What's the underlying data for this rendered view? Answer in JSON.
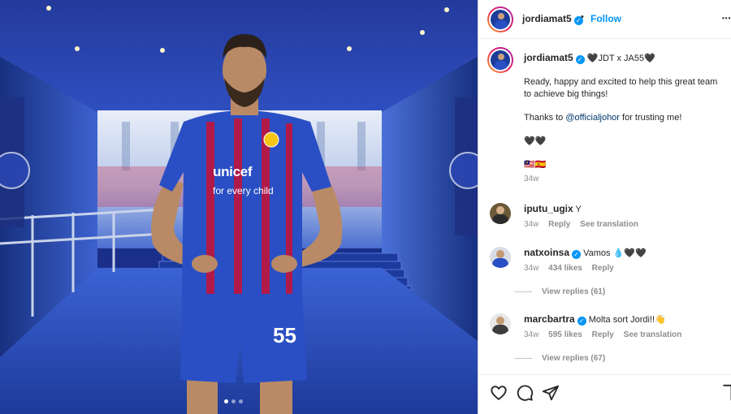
{
  "post": {
    "image_alt": "Football player in blue and red striped jersey standing in a stadium tunnel",
    "jersey_text": "unicef",
    "jersey_sub": "for every child",
    "shorts_number": "55",
    "carousel_dots": 3,
    "carousel_active": 0
  },
  "header": {
    "username": "jordiamat5",
    "verified": true,
    "separator": "•",
    "follow_label": "Follow",
    "more_label": "•••"
  },
  "caption": {
    "username": "jordiamat5",
    "title": "🖤JDT x JA55🖤",
    "line1": "Ready, happy and excited to help this great team to achieve big things!",
    "thanks_prefix": "Thanks to ",
    "mention": "@officialjohor",
    "thanks_suffix": " for trusting me!",
    "emoji1": "🖤🖤",
    "emoji2": "🇲🇾🇪🇸",
    "time": "34w"
  },
  "comments": [
    {
      "username": "iputu_ugix",
      "verified": false,
      "text": "Y",
      "time": "34w",
      "likes": "",
      "reply_label": "Reply",
      "translate_label": "See translation",
      "view_replies": ""
    },
    {
      "username": "natxoinsa",
      "verified": true,
      "text": "Vamos 💧🖤🖤",
      "time": "34w",
      "likes": "434 likes",
      "reply_label": "Reply",
      "translate_label": "",
      "view_replies": "View replies (61)"
    },
    {
      "username": "marcbartra",
      "verified": true,
      "text": "Molta sort Jordi!!👋",
      "time": "34w",
      "likes": "595 likes",
      "reply_label": "Reply",
      "translate_label": "See translation",
      "view_replies": "View replies (67)"
    }
  ],
  "actions": {
    "like_icon": "heart-icon",
    "comment_icon": "comment-icon",
    "share_icon": "send-icon",
    "save_icon": "bookmark-icon"
  },
  "colors": {
    "accent": "#0095f6",
    "jersey_blue": "#2a4fc4",
    "jersey_red": "#c0143c",
    "muted": "#8e8e8e"
  }
}
